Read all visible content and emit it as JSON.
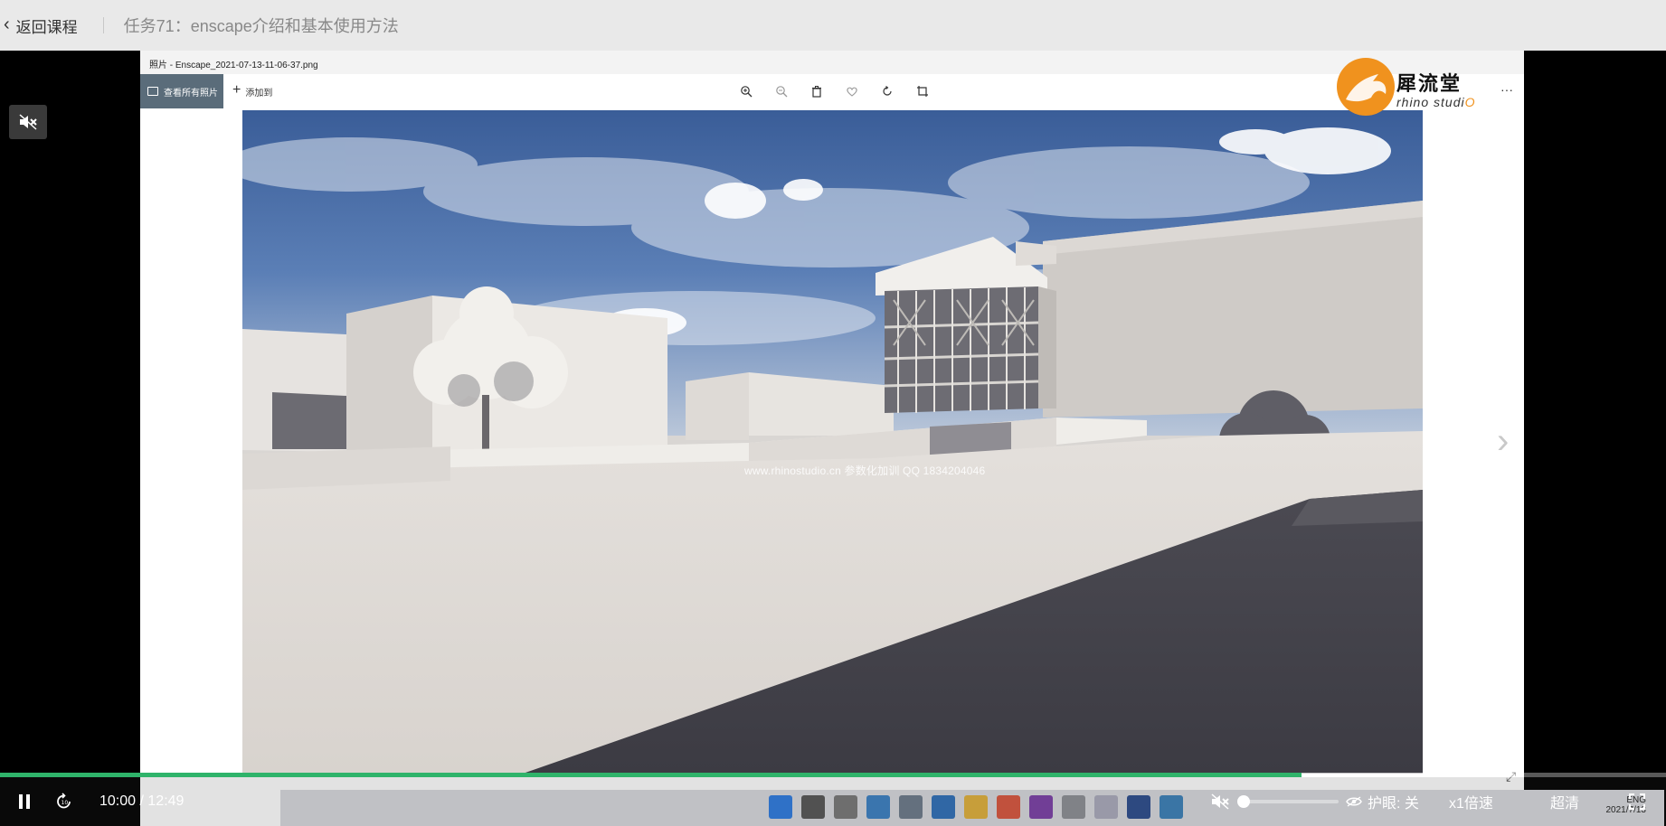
{
  "header": {
    "back_label": "返回课程",
    "task_title": "任务71：enscape介绍和基本使用方法"
  },
  "photos_app": {
    "window_title": "照片 - Enscape_2021-07-13-11-06-37.png",
    "view_all_label": "查看所有照片",
    "add_to_label": "添加到",
    "toolbar_icons": [
      "zoom-in-icon",
      "zoom-out-icon",
      "trash-icon",
      "heart-icon",
      "rotate-icon",
      "crop-icon"
    ],
    "more_label": "···"
  },
  "render": {
    "watermark": "www.rhinostudio.cn  参数化加训 QQ 1834204046"
  },
  "logo": {
    "cn": "犀流堂",
    "en_prefix": "rhino stud",
    "en_suffix": "i",
    "en_o": "O"
  },
  "taskbar": {
    "lang": "ENG",
    "date": "2021/7/13"
  },
  "player": {
    "time_current": "10:00",
    "time_sep": " / ",
    "time_total": "12:49",
    "progress": 0.781,
    "buffered": 0.868,
    "volume": 0.0,
    "eye_care_label": "护眼: 关",
    "speed_label": "x1倍速",
    "quality_label": "超清",
    "accent": "#2fb36a"
  }
}
